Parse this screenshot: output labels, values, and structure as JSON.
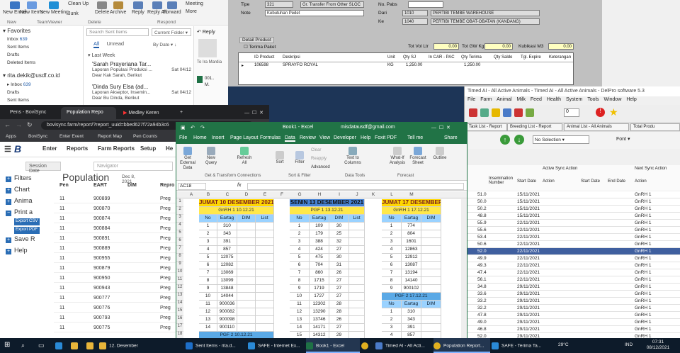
{
  "outlook": {
    "ribbon": {
      "new_email": "New Email",
      "new_items": "New Items",
      "new_meeting": "New Meeting",
      "clean_up": "Clean Up",
      "junk": "Junk",
      "delete": "Delete",
      "archive": "Archive",
      "reply": "Reply",
      "reply_all": "Reply All",
      "forward": "Forward",
      "more": "More",
      "meeting": "Meeting",
      "group_new": "New",
      "group_teamviewer": "TeamViewer",
      "group_delete": "Delete",
      "group_respond": "Respond"
    },
    "folders": {
      "favorites": "Favorites",
      "items": [
        {
          "name": "Inbox",
          "count": "639"
        },
        {
          "name": "Sent Items",
          "count": ""
        },
        {
          "name": "Drafts",
          "count": ""
        },
        {
          "name": "Deleted Items",
          "count": ""
        }
      ],
      "account": "rita.dekik@usdf.co.id",
      "account_items": [
        {
          "name": "Inbox",
          "count": "639"
        },
        {
          "name": "Drafts",
          "count": ""
        },
        {
          "name": "Sent Items",
          "count": ""
        }
      ]
    },
    "search_placeholder": "Search Sent Items",
    "current_folder": "Current Folder",
    "tab_all": "All",
    "tab_unread": "Unread",
    "sort": "By Date",
    "group": "Last Week",
    "messages": [
      {
        "from": "'Sarah Prayeriana Tar...",
        "subject": "Laporan Populasi Produksi ...",
        "date": "Sat 04/12",
        "preview": "Dear Kak Sarah, Berikut"
      },
      {
        "from": "'Dinda Sury Elsa (ad...",
        "subject": "Laporan Akseptor, Insemin...",
        "date": "Sat 04/12",
        "preview": "Dear Bu Dinda, Berikut"
      }
    ],
    "reading": {
      "reply": "Reply",
      "to": "To",
      "name": "Ira Mardia",
      "file1": "001..",
      "file2": "M."
    }
  },
  "safe": {
    "tipe_label": "Tipe",
    "tipe_code": "321",
    "tipe_desc": "Gr. Transfer From Other SLOC",
    "note_label": "Note",
    "note_val": "Kebutuhan Pedet",
    "nopabs_label": "No. Pabs",
    "dari_label": "Dari",
    "dari_code": "1010",
    "dari_name": "PERTIBI TEMBE WAREHOUSE",
    "ke_label": "Ke",
    "ke_code": "1040",
    "ke_name": "PERTIBI TEMBE OBAT-OBATAN (KANDANG)",
    "tot_vol": "Tot Vol Ltr",
    "tot_vol_v": "0.00",
    "tot_gw": "Tot GW Kg",
    "tot_gw_v": "0.00",
    "kubikasi": "Kubikasi M3",
    "kubikasi_v": "0.00",
    "detail": "Detail Product",
    "terima_paket": "Terima Paket",
    "cols": [
      "ID Product",
      "Deskripsi",
      "Unit",
      "Qty SJ",
      "In CAR - PAC",
      "Qty Terima",
      "Qty Saldo",
      "Tgl. Expire",
      "Keterangan"
    ],
    "row": {
      "id": "106598",
      "desc": "SPRAYFO ROYAL",
      "unit": "KG",
      "qty_sj": "1,250.00",
      "qty_terima": "1,250.00"
    }
  },
  "delpro": {
    "title": "Timed AI - All Active Animals - Timed AI - All Active Animals - DelPro software 5.3",
    "menu": [
      "File",
      "Farm",
      "Animal",
      "Milk",
      "Feed",
      "Health",
      "System",
      "Tools",
      "Window",
      "Help"
    ],
    "tabs": [
      "Task List - Report",
      "Breeding List - Report",
      "Animal List - All Animals",
      "Total Produ"
    ],
    "selection": "No Selection",
    "font": "Font",
    "groups": [
      "Active Sync Action",
      "Next Sync Action"
    ],
    "cols": [
      "Insemination Number",
      "Start Date",
      "Action",
      "Start Date",
      "End Date",
      "Action"
    ],
    "rows": [
      [
        "51.0",
        "15/11/2021",
        "GnRH 1"
      ],
      [
        "50.0",
        "15/11/2021",
        "GnRH 1"
      ],
      [
        "50.2",
        "15/11/2021",
        "GnRH 1"
      ],
      [
        "48.8",
        "15/11/2021",
        "GnRH 1"
      ],
      [
        "55.9",
        "22/11/2021",
        "GnRH 1"
      ],
      [
        "55.6",
        "22/11/2021",
        "GnRH 1"
      ],
      [
        "53.4",
        "22/11/2021",
        "GnRH 1"
      ],
      [
        "50.6",
        "22/11/2021",
        "GnRH 1"
      ],
      [
        "52.0",
        "22/11/2021",
        "GnRH 1"
      ],
      [
        "49.9",
        "22/11/2021",
        "GnRH 1"
      ],
      [
        "49.3",
        "22/11/2021",
        "GnRH 1"
      ],
      [
        "47.4",
        "22/11/2021",
        "GnRH 1"
      ],
      [
        "56.1",
        "22/11/2021",
        "GnRH 1"
      ],
      [
        "34.8",
        "29/11/2021",
        "GnRH 1"
      ],
      [
        "33.6",
        "29/11/2021",
        "GnRH 1"
      ],
      [
        "33.2",
        "29/11/2021",
        "GnRH 1"
      ],
      [
        "32.2",
        "29/11/2021",
        "GnRH 1"
      ],
      [
        "47.8",
        "29/11/2021",
        "GnRH 1"
      ],
      [
        "49.0",
        "29/11/2021",
        "GnRH 1"
      ],
      [
        "46.8",
        "29/11/2021",
        "GnRH 1"
      ],
      [
        "52.0",
        "29/11/2021",
        "GnRH 1"
      ],
      [
        "52.6",
        "29/11/2021",
        "GnRH 1"
      ]
    ],
    "selected_index": 8
  },
  "browser": {
    "tabs": [
      "Pens - BoviSync",
      "Population Repo",
      "Medley Keren"
    ],
    "url": "bovisync.farm/report/?report_uuid=bbed627f72a94b3c6",
    "bookmarks": [
      "Apps",
      "BoviSync",
      "Enter Event",
      "Report Map",
      "Pen Counts"
    ],
    "nav": [
      "Enter",
      "Reports",
      "Farm Reports",
      "Setup",
      "He"
    ],
    "session_date": "Session Date",
    "navigator": "Navigator",
    "heading": "Population",
    "report_date": "Dec 8, 2021",
    "side": [
      "Filters",
      "Chart",
      "Anima",
      "Print a",
      "Save R",
      "Help"
    ],
    "export_csv": "Export CSV",
    "export_pdf": "Export PDF",
    "cols": [
      "Pen",
      "EART",
      "DIM",
      "Repro"
    ],
    "rows": [
      [
        "11",
        "900899",
        "Preg"
      ],
      [
        "11",
        "900870",
        "Preg"
      ],
      [
        "11",
        "900874",
        "Preg"
      ],
      [
        "11",
        "900884",
        "Preg"
      ],
      [
        "11",
        "900891",
        "Preg"
      ],
      [
        "11",
        "900889",
        "Preg"
      ],
      [
        "11",
        "900955",
        "Preg"
      ],
      [
        "11",
        "900879",
        "Preg"
      ],
      [
        "11",
        "900950",
        "Preg"
      ],
      [
        "11",
        "900943",
        "Preg"
      ],
      [
        "11",
        "900777",
        "Preg"
      ],
      [
        "11",
        "900776",
        "Preg"
      ],
      [
        "11",
        "900793",
        "Preg"
      ],
      [
        "11",
        "900775",
        "Preg"
      ]
    ]
  },
  "excel": {
    "title": "Book1 - Excel",
    "user": "misdatausdf@gmail.com",
    "menu": [
      "File",
      "Home",
      "Insert",
      "Page Layout",
      "Formulas",
      "Data",
      "Review",
      "View",
      "Developer",
      "Help",
      "Foxit PDF",
      "Tell me",
      "Share"
    ],
    "ribbon": {
      "get_external": "Get External Data",
      "new_query": "New Query",
      "refresh_all": "Refresh All",
      "sort": "Sort",
      "filter": "Filter",
      "clear": "Clear",
      "reapply": "Reapply",
      "advanced": "Advanced",
      "text_to_columns": "Text to Columns",
      "what_if": "What-If Analysis",
      "forecast_sheet": "Forecast Sheet",
      "outline": "Outline",
      "grp_get": "Get & Transform",
      "grp_conn": "Connections",
      "grp_sort": "Sort & Filter",
      "grp_tools": "Data Tools",
      "grp_forecast": "Forecast"
    },
    "cellref": "AC18",
    "fx": "fx",
    "col_letters": [
      "A",
      "B",
      "C",
      "D",
      "E",
      "F",
      "G",
      "H",
      "I",
      "J",
      "K",
      "L",
      "M"
    ],
    "block1": {
      "title": "JUMAT 10 DESEMBER 2021",
      "sub": "GnRH 1 10.12.21",
      "cols": [
        "No",
        "Eartag",
        "DIM",
        "List"
      ],
      "rows": [
        [
          "1",
          "310"
        ],
        [
          "2",
          "343"
        ],
        [
          "3",
          "391"
        ],
        [
          "4",
          "857"
        ],
        [
          "5",
          "12075"
        ],
        [
          "6",
          "12082"
        ],
        [
          "7",
          "13069"
        ],
        [
          "8",
          "13099"
        ],
        [
          "9",
          "13848"
        ],
        [
          "10",
          "14044"
        ],
        [
          "11",
          "900036"
        ],
        [
          "12",
          "900082"
        ],
        [
          "13",
          "900098"
        ],
        [
          "14",
          "900110"
        ]
      ],
      "sub2": "PGF 2 10.12.21",
      "cols2": [
        "No",
        "Eartag",
        "DIM",
        "List"
      ]
    },
    "block2": {
      "title": "SENIN 13 DESEMBER 2021",
      "sub": "PGF 1 13.12.21",
      "cols": [
        "No",
        "Eartag",
        "DIM",
        "List"
      ],
      "rows": [
        [
          "1",
          "109"
        ],
        [
          "2",
          "179"
        ],
        [
          "3",
          "388"
        ],
        [
          "4",
          "424"
        ],
        [
          "5",
          "475"
        ],
        [
          "6",
          "704"
        ],
        [
          "7",
          "860"
        ],
        [
          "8",
          "1715"
        ],
        [
          "9",
          "1719"
        ],
        [
          "10",
          "1727"
        ],
        [
          "11",
          "12302"
        ],
        [
          "12",
          "13290"
        ],
        [
          "13",
          "13746"
        ],
        [
          "14",
          "14171"
        ],
        [
          "15",
          "14312"
        ],
        [
          "16",
          "14314"
        ]
      ],
      "dim": [
        "30",
        "25",
        "32",
        "27",
        "30",
        "31",
        "26",
        "27",
        "27",
        "27",
        "28",
        "28",
        "26",
        "27",
        "29",
        "28"
      ]
    },
    "block3": {
      "title": "JUMAT 17 DESEMBER",
      "sub": "GnRH 1 17.12.21",
      "cols": [
        "No",
        "Eartag",
        "DIM"
      ],
      "rows": [
        [
          "1",
          "774"
        ],
        [
          "2",
          "804"
        ],
        [
          "3",
          "1601"
        ],
        [
          "4",
          "12863"
        ],
        [
          "5",
          "12912"
        ],
        [
          "6",
          "13087"
        ],
        [
          "7",
          "13194"
        ],
        [
          "8",
          "14140"
        ],
        [
          "9",
          "900102"
        ]
      ],
      "sub2": "PGF 2 17.12.21",
      "cols2": [
        "No",
        "Eartag",
        "DIM"
      ],
      "rows2": [
        [
          "1",
          "310"
        ],
        [
          "2",
          "343"
        ],
        [
          "3",
          "391"
        ],
        [
          "4",
          "857"
        ],
        [
          "5",
          "12075"
        ]
      ]
    }
  },
  "taskbar": {
    "items": [
      "12. Desember",
      "Sent Items - rita.d...",
      "SAFE - Internet Ex...",
      "Book1 - Excel",
      "",
      "Timed AI - All Acti...",
      "Population Report...",
      "SAFE - Terima Ta..."
    ],
    "temp": "29°C",
    "lang": "IND",
    "time": "07:31",
    "date": "08/12/2021"
  }
}
